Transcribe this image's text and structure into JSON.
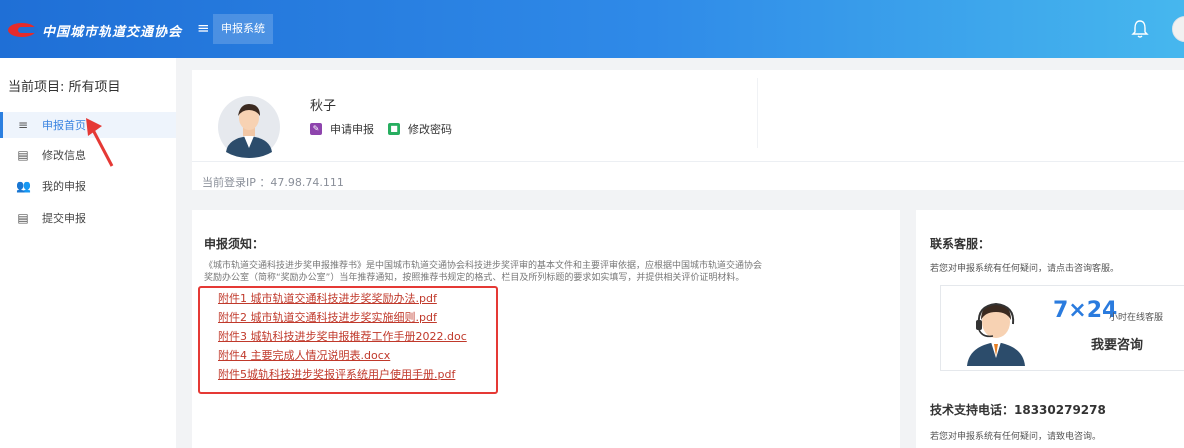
{
  "header": {
    "logo_text": "中国城市轨道交通协会",
    "menu_icon": "hamburger-icon",
    "active_tab": "申报系统",
    "bell_icon": "bell-icon"
  },
  "sidebar": {
    "current_project": "当前项目: 所有项目",
    "items": [
      {
        "label": "申报首页",
        "icon": "list-icon",
        "active": true
      },
      {
        "label": "修改信息",
        "icon": "form-icon",
        "active": false
      },
      {
        "label": "我的申报",
        "icon": "users-icon",
        "active": false
      },
      {
        "label": "提交申报",
        "icon": "form-icon",
        "active": false
      }
    ]
  },
  "profile": {
    "name": "秋子",
    "apply_label": "申请申报",
    "password_label": "修改密码",
    "login_ip": "当前登录IP ：47.98.74.111"
  },
  "notice": {
    "title": "申报须知：",
    "body_line1": "《城市轨道交通科技进步奖申报推荐书》是中国城市轨道交通协会科技进步奖评审的基本文件和主要评审依据，应根据中国城市轨道交通协会",
    "body_line2": "奖励办公室（简称“奖励办公室”）当年推荐通知，按照推荐书规定的格式、栏目及所列标题的要求如实填写，并提供相关评价证明材料。",
    "attachments": [
      "附件1 城市轨道交通科技进步奖奖励办法.pdf",
      "附件2 城市轨道交通科技进步奖实施细则.pdf",
      "附件3 城轨科技进步奖申报推荐工作手册2022.doc",
      "附件4 主要完成人情况说明表.docx",
      "附件5城轨科技进步奖报评系统用户使用手册.pdf"
    ]
  },
  "contact": {
    "title": "联系客服：",
    "desc": "若您对申报系统有任何疑问，请点击咨询客服。",
    "service_hours": "7×24",
    "online_label": "小时在线客服",
    "consult_label": "我要咨询",
    "tel": "技术支持电话：18330279278",
    "tel_desc": "若您对申报系统有任何疑问，请致电咨询。"
  },
  "colors": {
    "header_start": "#1f6fd6",
    "header_end": "#46b7ee",
    "link_red": "#c0392b",
    "annotation_red": "#e53935"
  }
}
